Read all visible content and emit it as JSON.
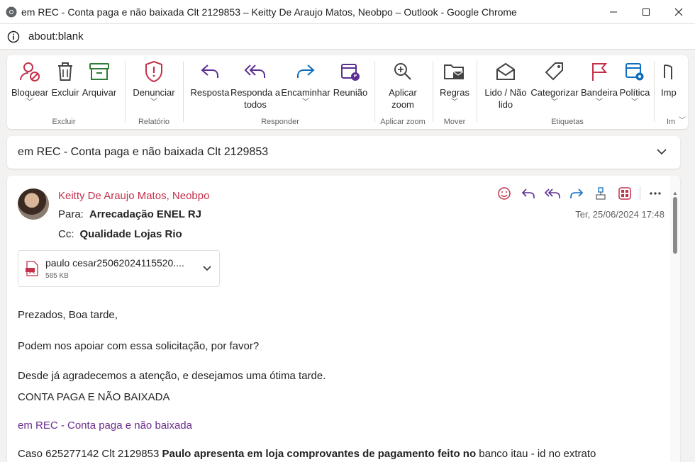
{
  "window": {
    "title": "em REC - Conta paga e não baixada Clt 2129853 – Keitty De Araujo Matos, Neobpo – Outlook - Google Chrome",
    "url": "about:blank"
  },
  "ribbon": {
    "groups": [
      {
        "label": "Excluir",
        "buttons": [
          "Bloquear",
          "Excluir",
          "Arquivar"
        ]
      },
      {
        "label": "Relatório",
        "buttons": [
          "Denunciar"
        ]
      },
      {
        "label": "Responder",
        "buttons": [
          "Resposta",
          "Responda a todos",
          "Encaminhar",
          "Reunião"
        ]
      },
      {
        "label": "Aplicar zoom",
        "buttons": [
          "Aplicar zoom"
        ]
      },
      {
        "label": "Mover",
        "buttons": [
          "Regras"
        ]
      },
      {
        "label": "Etiquetas",
        "buttons": [
          "Lido / Não lido",
          "Categorizar",
          "Bandeira",
          "Política"
        ]
      },
      {
        "label": "Im",
        "buttons": [
          "Imp"
        ]
      }
    ],
    "btn": {
      "bloquear": "Bloquear",
      "excluir": "Excluir",
      "arquivar": "Arquivar",
      "denunciar": "Denunciar",
      "resposta": "Resposta",
      "responda1": "Responda a",
      "responda2": "todos",
      "encaminhar": "Encaminhar",
      "reuniao": "Reunião",
      "zoom1": "Aplicar",
      "zoom2": "zoom",
      "regras": "Regras",
      "lido1": "Lido / Não",
      "lido2": "lido",
      "categorizar": "Categorizar",
      "bandeira": "Bandeira",
      "politica": "Política",
      "imp": "Imp"
    },
    "group_labels": {
      "excluir": "Excluir",
      "relatorio": "Relatório",
      "responder": "Responder",
      "zoom": "Aplicar zoom",
      "mover": "Mover",
      "etiquetas": "Etiquetas",
      "im": "Im"
    }
  },
  "message": {
    "subject": "em REC - Conta paga e não baixada Clt 2129853",
    "sender": "Keitty De Araujo Matos, Neobpo",
    "to_label": "Para:",
    "to": "Arrecadação ENEL RJ",
    "cc_label": "Cc:",
    "cc": "Qualidade Lojas Rio",
    "date": "Ter, 25/06/2024 17:48",
    "attachment": {
      "name": "paulo cesar25062024115520....",
      "size": "585 KB"
    },
    "body": {
      "greeting": "Prezados, Boa tarde,",
      "p1": "Podem nos apoiar com essa solicitação, por favor?",
      "p2": "Desde já agradecemos a atenção, e desejamos uma ótima tarde.",
      "p3": "CONTA PAGA E NÃO BAIXADA",
      "link": "em REC - Conta paga e não baixada",
      "p4_start": "Caso 625277142 Clt 2129853 ",
      "p4_bold": "Paulo apresenta em loja comprovantes de pagamento feito no",
      "p4_end": "  banco itau - id no extrato"
    }
  },
  "colors": {
    "accent": "#0f6cbd",
    "sender": "#c4314b",
    "reply_icons": "#5c2e91",
    "link": "#6b2d8c"
  }
}
